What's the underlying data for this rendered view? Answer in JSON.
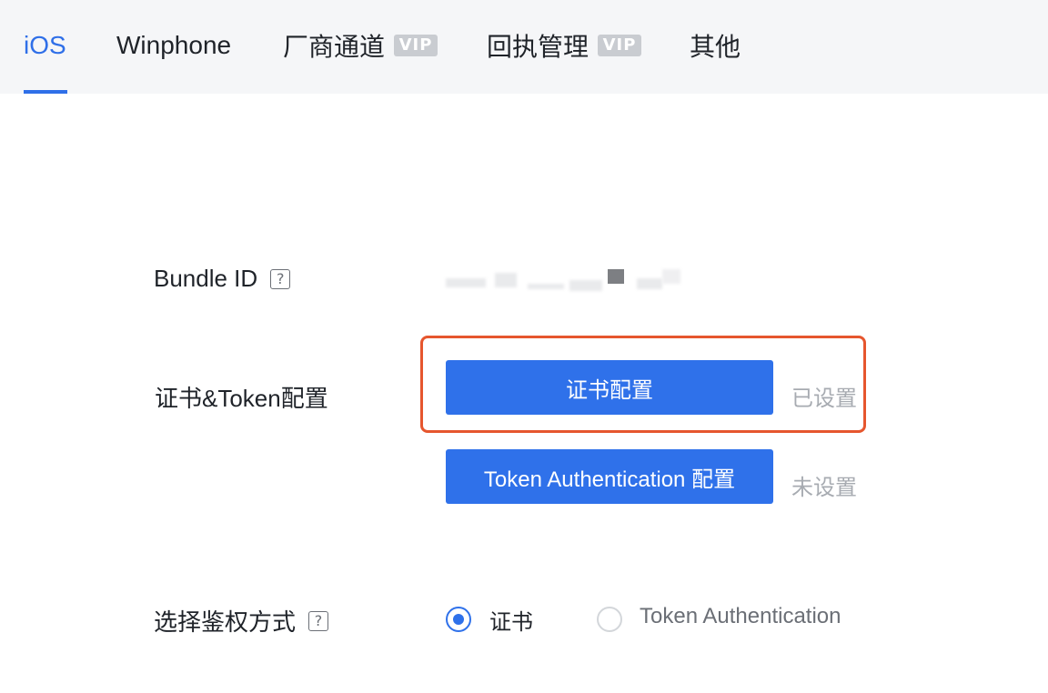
{
  "tabs": [
    {
      "label": "iOS",
      "active": true
    },
    {
      "label": "Winphone",
      "active": false
    },
    {
      "label": "厂商通道",
      "badge": "VIP",
      "active": false
    },
    {
      "label": "回执管理",
      "badge": "VIP",
      "active": false
    },
    {
      "label": "其他",
      "active": false
    }
  ],
  "form": {
    "bundle_id_label": "Bundle ID",
    "help_glyph": "?",
    "cert_token_label": "证书&Token配置",
    "cert_button": "证书配置",
    "cert_status": "已设置",
    "token_button": "Token Authentication 配置",
    "token_status": "未设置",
    "auth_method_label": "选择鉴权方式",
    "auth_options": [
      {
        "label": "证书",
        "selected": true
      },
      {
        "label": "Token Authentication",
        "selected": false
      }
    ]
  },
  "colors": {
    "accent": "#2f71ea",
    "highlight_border": "#e6562e",
    "muted_text": "#a7abb1",
    "vip_badge": "#c9ccd1"
  },
  "icons": {
    "help": "question-mark-square-icon",
    "radio_selected": "radio-checked-icon",
    "radio_unselected": "radio-unchecked-icon"
  }
}
